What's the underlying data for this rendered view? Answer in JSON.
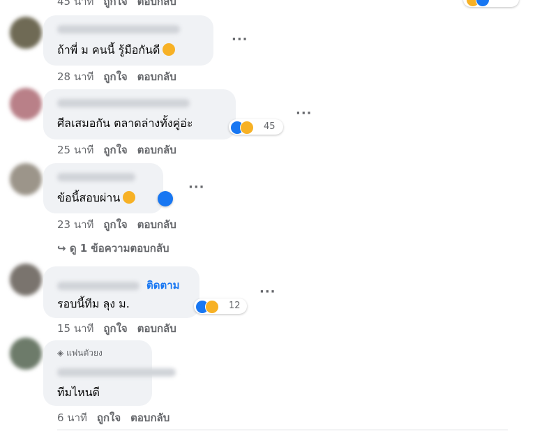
{
  "top_partial": {
    "time": "45 นาที",
    "like": "ถูกใจ",
    "reply": "ตอบกลับ"
  },
  "comments": [
    {
      "text": "ถ้าพี่ ม คนนี้ รู้มือกันดี",
      "time": "28 นาที",
      "like": "ถูกใจ",
      "reply": "ตอบกลับ"
    },
    {
      "text": "ศีลเสมอกัน ตลาดล่างทั้งคู่อ่ะ",
      "reaction_count": "45",
      "time": "25 นาที",
      "like": "ถูกใจ",
      "reply": "ตอบกลับ"
    },
    {
      "text": "ข้อนี้สอบผ่าน",
      "time": "23 นาที",
      "like": "ถูกใจ",
      "reply": "ตอบกลับ",
      "view_replies": "ดู 1 ข้อความตอบกลับ"
    },
    {
      "follow": "ติดตาม",
      "text": "รอบนี้ทีม ลุง ม.",
      "reaction_count": "12",
      "time": "15 นาที",
      "like": "ถูกใจ",
      "reply": "ตอบกลับ"
    },
    {
      "badge": "แฟนตัวยง",
      "text": "ทีมไหนดี",
      "time": "6 นาที",
      "like": "ถูกใจ",
      "reply": "ตอบกลับ"
    }
  ],
  "icons": {
    "more": "more-dots-icon",
    "like": "like-reaction-icon",
    "haha": "haha-reaction-icon",
    "reply_arrow": "reply-arrow-icon",
    "badge": "diamond-icon"
  },
  "colors": {
    "link": "#1877f2",
    "meta": "#65676b",
    "bubble": "#f0f2f5",
    "text": "#050505"
  }
}
